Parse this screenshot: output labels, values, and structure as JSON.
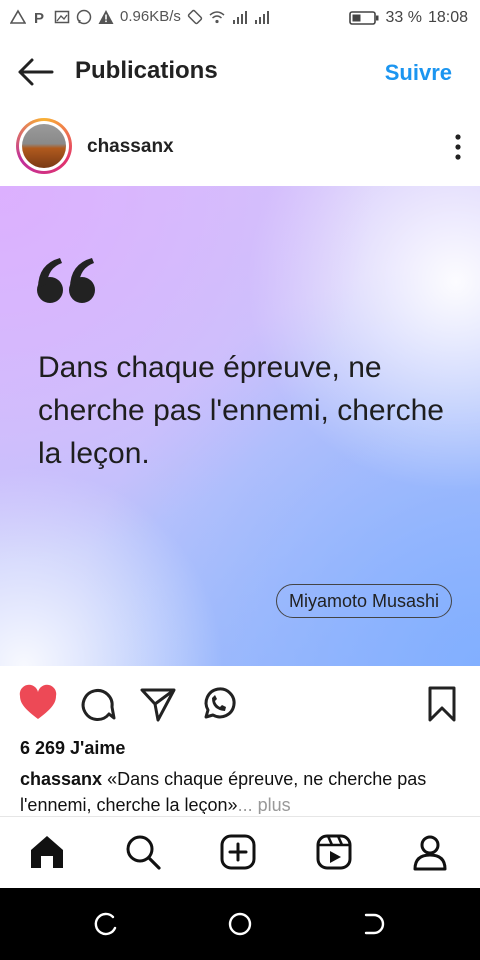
{
  "status_bar": {
    "net_speed": "0.96KB/s",
    "battery": "33 %",
    "time": "18:08"
  },
  "header": {
    "title": "Publications",
    "follow_label": "Suivre"
  },
  "author": {
    "username": "chassanx"
  },
  "post": {
    "quote": "Dans chaque épreuve, ne cherche pas l'ennemi, cherche la leçon.",
    "quote_author": "Miyamoto Musashi"
  },
  "engagement": {
    "likes": "6 269 J'aime",
    "liked": true,
    "caption_user": "chassanx",
    "caption_text": "«Dans chaque épreuve, ne cherche pas l'ennemi, cherche la leçon»",
    "more_label": "... plus"
  },
  "bottom_nav": {
    "items": [
      "home-icon",
      "search-icon",
      "create-icon",
      "reels-icon",
      "profile-icon"
    ]
  },
  "colors": {
    "accent": "#1b95f0",
    "like": "#ed4956"
  }
}
